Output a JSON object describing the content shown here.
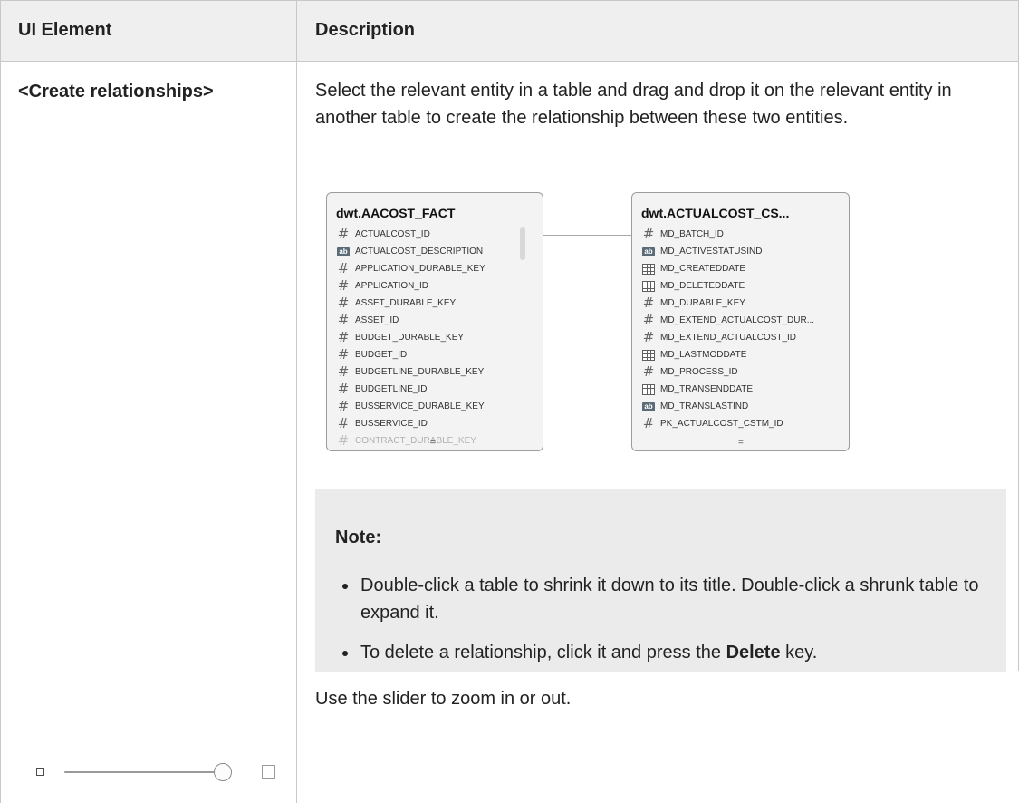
{
  "table": {
    "headers": [
      "UI Element",
      "Description"
    ]
  },
  "row1": {
    "element": "<Create relationships>",
    "description": "Select the relevant entity in a table and drag and drop it on the relevant entity in another table to create the relationship between these two entities."
  },
  "diagram": {
    "table1": {
      "title": "dwt.AACOST_FACT",
      "columns": [
        {
          "icon": "number-icon",
          "name": "ACTUALCOST_ID"
        },
        {
          "icon": "text-icon",
          "name": "ACTUALCOST_DESCRIPTION"
        },
        {
          "icon": "number-icon",
          "name": "APPLICATION_DURABLE_KEY"
        },
        {
          "icon": "number-icon",
          "name": "APPLICATION_ID"
        },
        {
          "icon": "number-icon",
          "name": "ASSET_DURABLE_KEY"
        },
        {
          "icon": "number-icon",
          "name": "ASSET_ID"
        },
        {
          "icon": "number-icon",
          "name": "BUDGET_DURABLE_KEY"
        },
        {
          "icon": "number-icon",
          "name": "BUDGET_ID"
        },
        {
          "icon": "number-icon",
          "name": "BUDGETLINE_DURABLE_KEY"
        },
        {
          "icon": "number-icon",
          "name": "BUDGETLINE_ID"
        },
        {
          "icon": "number-icon",
          "name": "BUSSERVICE_DURABLE_KEY"
        },
        {
          "icon": "number-icon",
          "name": "BUSSERVICE_ID"
        },
        {
          "icon": "number-icon",
          "name": "CONTRACT_DURABLE_KEY"
        }
      ]
    },
    "table2": {
      "title": "dwt.ACTUALCOST_CS...",
      "columns": [
        {
          "icon": "number-icon",
          "name": "MD_BATCH_ID"
        },
        {
          "icon": "text-icon",
          "name": "MD_ACTIVESTATUSIND"
        },
        {
          "icon": "date-icon",
          "name": "MD_CREATEDDATE"
        },
        {
          "icon": "date-icon",
          "name": "MD_DELETEDDATE"
        },
        {
          "icon": "number-icon",
          "name": "MD_DURABLE_KEY"
        },
        {
          "icon": "number-icon",
          "name": "MD_EXTEND_ACTUALCOST_DUR..."
        },
        {
          "icon": "number-icon",
          "name": "MD_EXTEND_ACTUALCOST_ID"
        },
        {
          "icon": "date-icon",
          "name": "MD_LASTMODDATE"
        },
        {
          "icon": "number-icon",
          "name": "MD_PROCESS_ID"
        },
        {
          "icon": "date-icon",
          "name": "MD_TRANSENDDATE"
        },
        {
          "icon": "text-icon",
          "name": "MD_TRANSLASTIND"
        },
        {
          "icon": "number-icon",
          "name": "PK_ACTUALCOST_CSTM_ID"
        }
      ]
    },
    "icon_glyphs": {
      "number": "#",
      "text": "ab"
    },
    "grip_glyph": "="
  },
  "note": {
    "title": "Note:",
    "items": [
      {
        "text": "Double-click a table to shrink it down to its title. Double-click a shrunk table to expand it."
      },
      {
        "before": "To delete a relationship, click it and press the ",
        "bold": "Delete",
        "after": " key."
      }
    ]
  },
  "row2": {
    "description": "Use the slider to zoom in or out.",
    "slider_level": 1.0
  }
}
